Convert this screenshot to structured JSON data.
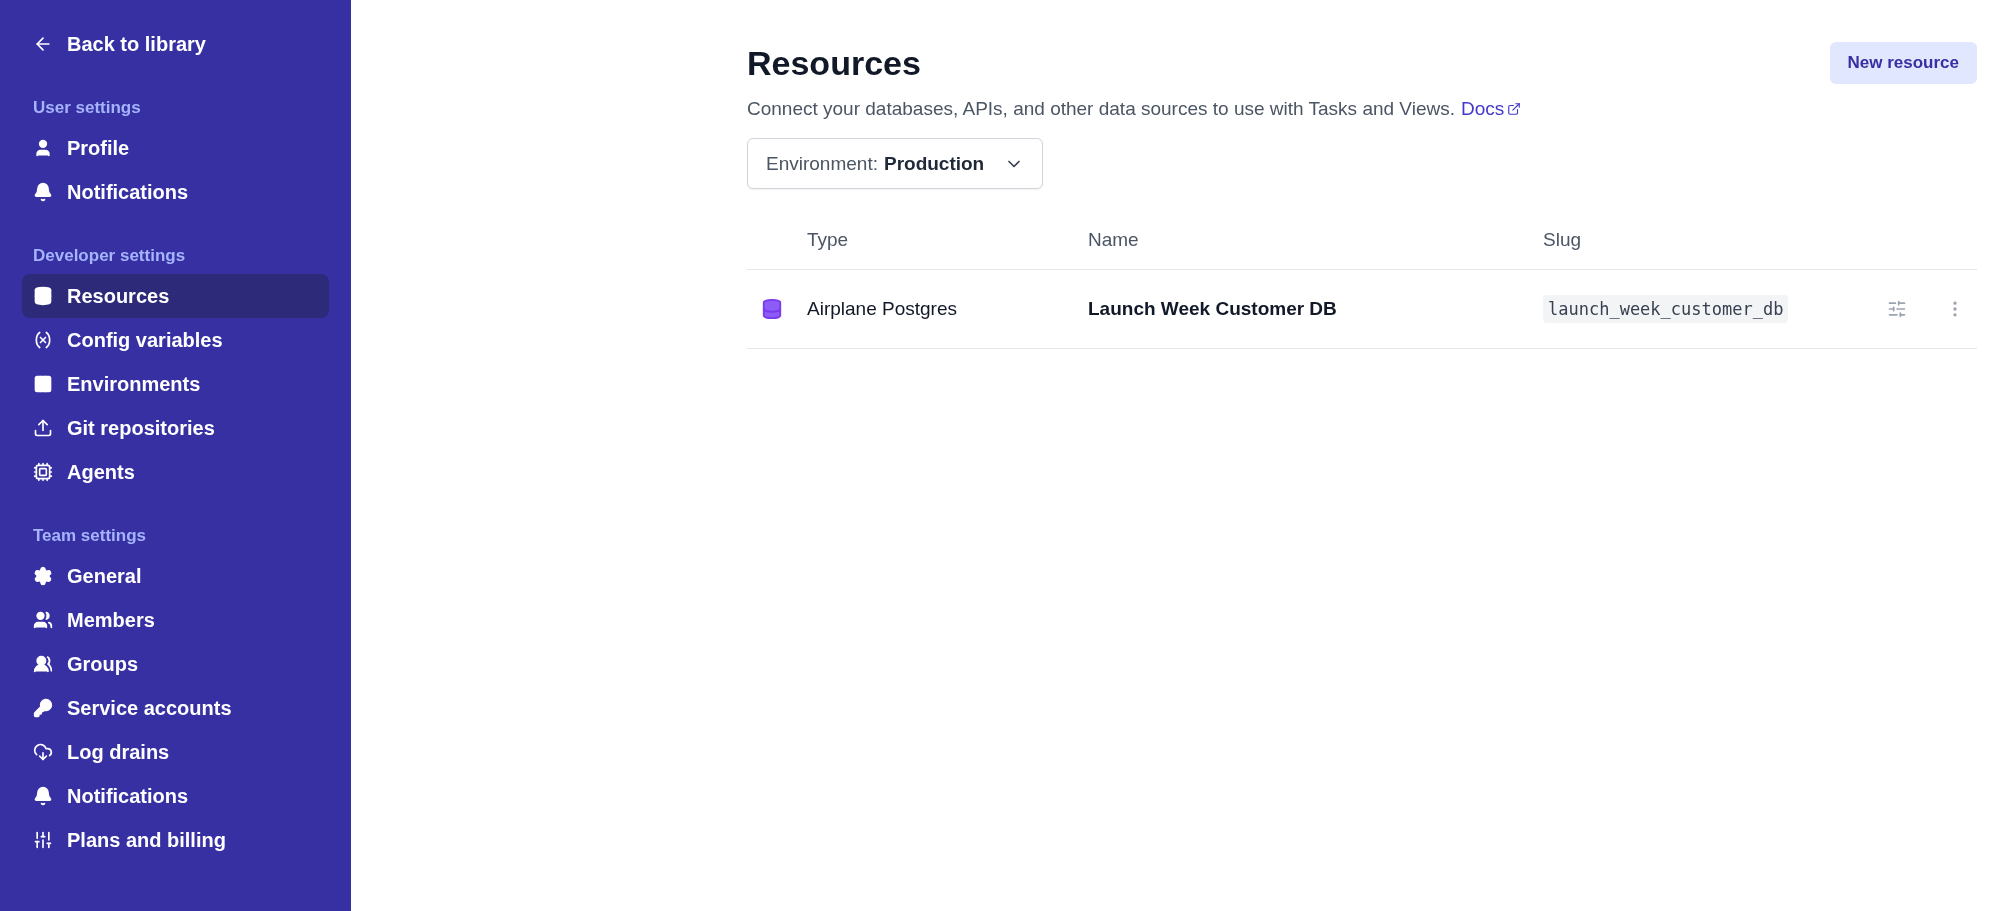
{
  "sidebar": {
    "back": "Back to library",
    "sections": [
      {
        "title": "User settings",
        "items": [
          {
            "label": "Profile",
            "selected": false
          },
          {
            "label": "Notifications",
            "selected": false
          }
        ]
      },
      {
        "title": "Developer settings",
        "items": [
          {
            "label": "Resources",
            "selected": true
          },
          {
            "label": "Config variables",
            "selected": false
          },
          {
            "label": "Environments",
            "selected": false
          },
          {
            "label": "Git repositories",
            "selected": false
          },
          {
            "label": "Agents",
            "selected": false
          }
        ]
      },
      {
        "title": "Team settings",
        "items": [
          {
            "label": "General",
            "selected": false
          },
          {
            "label": "Members",
            "selected": false
          },
          {
            "label": "Groups",
            "selected": false
          },
          {
            "label": "Service accounts",
            "selected": false
          },
          {
            "label": "Log drains",
            "selected": false
          },
          {
            "label": "Notifications",
            "selected": false
          },
          {
            "label": "Plans and billing",
            "selected": false
          }
        ]
      }
    ]
  },
  "page": {
    "title": "Resources",
    "new_button": "New resource",
    "description": "Connect your databases, APIs, and other data sources to use with Tasks and Views.",
    "docs_link": "Docs",
    "environment": {
      "label": "Environment:",
      "value": "Production"
    },
    "table": {
      "columns": [
        "Type",
        "Name",
        "Slug"
      ],
      "rows": [
        {
          "type": "Airplane Postgres",
          "name": "Launch Week Customer DB",
          "slug": "launch_week_customer_db"
        }
      ]
    }
  }
}
